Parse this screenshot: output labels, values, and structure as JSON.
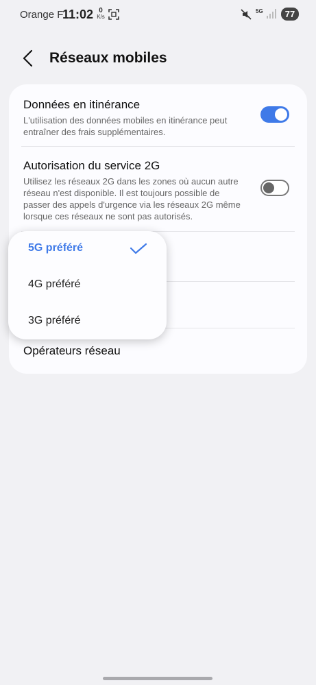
{
  "status_bar": {
    "carrier": "Orange F",
    "time": "11:02",
    "data_speed_value": "0",
    "data_speed_unit": "K/s",
    "network_type": "5G",
    "battery": "77"
  },
  "header": {
    "title": "Réseaux mobiles"
  },
  "settings": {
    "roaming": {
      "title": "Données en itinérance",
      "description": "L'utilisation des données mobiles en itinérance peut entraîner des frais supplémentaires.",
      "enabled": true
    },
    "service_2g": {
      "title": "Autorisation du service 2G",
      "description": "Utilisez les réseaux 2G dans les zones où aucun autre réseau n'est disponible. Il est toujours possible de passer des appels d'urgence via les réseaux 2G même lorsque ces réseaux ne sont pas autorisés.",
      "enabled": false
    },
    "operators": {
      "title": "Opérateurs réseau"
    }
  },
  "network_mode_menu": {
    "items": [
      {
        "label": "5G préféré",
        "selected": true
      },
      {
        "label": "4G préféré",
        "selected": false
      },
      {
        "label": "3G préféré",
        "selected": false
      }
    ]
  },
  "colors": {
    "accent": "#3f7ae8",
    "background": "#f1f1f4",
    "card": "#fcfcff"
  }
}
